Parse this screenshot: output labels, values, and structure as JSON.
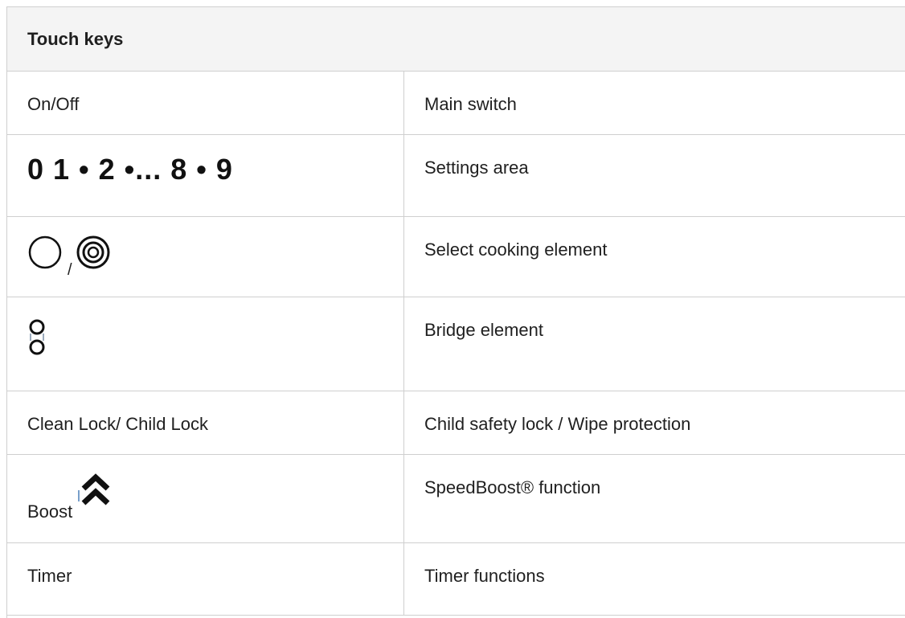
{
  "table": {
    "header": "Touch keys",
    "rows": [
      {
        "left": "On/Off",
        "right": "Main switch"
      },
      {
        "left": "0 1 • 2 •... 8 • 9",
        "right": "Settings area"
      },
      {
        "left_separator": "/",
        "left_icons": [
          "single-circle-icon",
          "double-circle-icon"
        ],
        "right": "Select cooking element"
      },
      {
        "left_icons": [
          "bridge-element-icon"
        ],
        "right": "Bridge element"
      },
      {
        "left": "Clean Lock/ Child Lock",
        "right": "Child safety lock / Wipe protection"
      },
      {
        "left": "Boost",
        "left_icons": [
          "double-chevron-up-icon"
        ],
        "right": "SpeedBoost® function"
      },
      {
        "left": "Timer",
        "right": "Timer functions"
      }
    ]
  }
}
